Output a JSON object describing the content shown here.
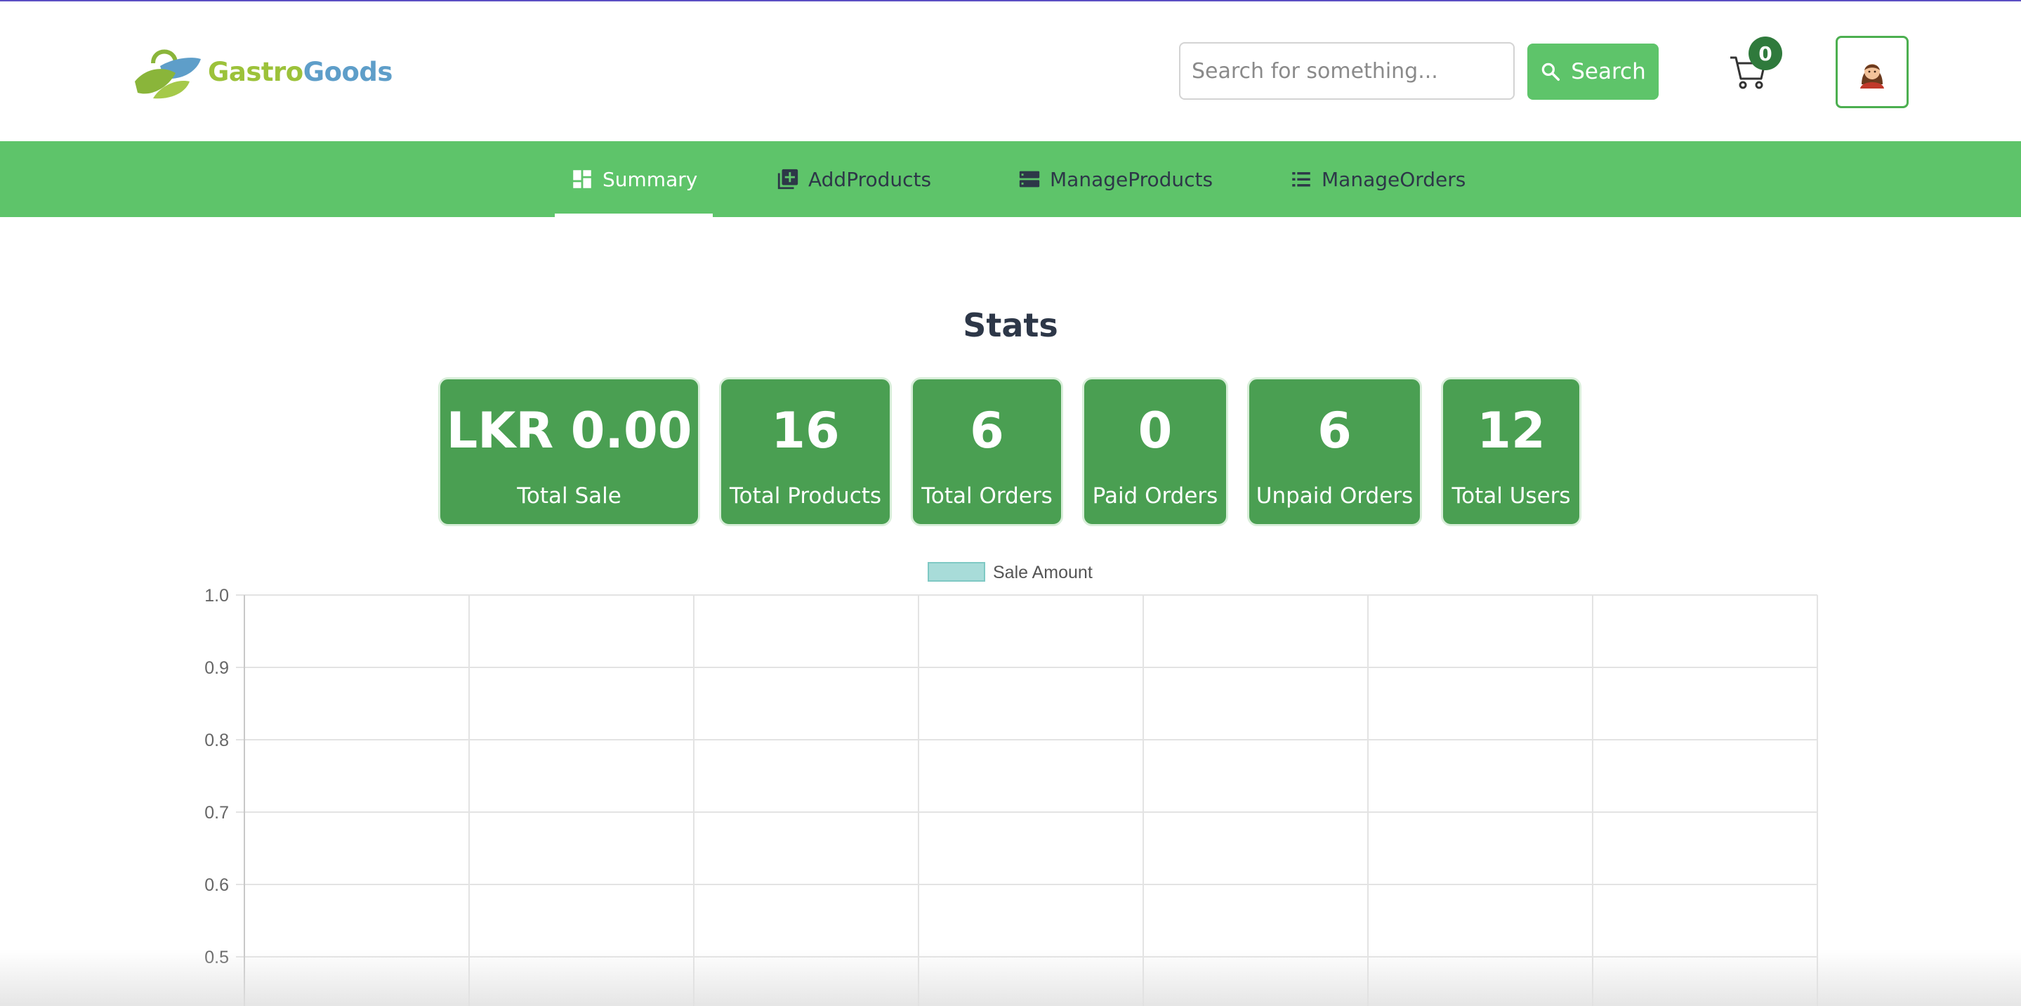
{
  "brand": {
    "name_part1": "Gastro",
    "name_part2": "Goods",
    "colors": {
      "part1": "#9cc23a",
      "part2": "#5e9ec9"
    }
  },
  "header": {
    "search": {
      "placeholder": "Search for something...",
      "value": ""
    },
    "search_button_label": "Search",
    "search_icon": "search-icon",
    "cart_icon": "cart-icon",
    "cart_count": "0",
    "avatar_icon": "woman-avatar-icon"
  },
  "nav": {
    "items": [
      {
        "label": "Summary",
        "icon": "dashboard-icon",
        "active": true
      },
      {
        "label": "AddProducts",
        "icon": "add-box-icon",
        "active": false
      },
      {
        "label": "ManageProducts",
        "icon": "storage-icon",
        "active": false
      },
      {
        "label": "ManageOrders",
        "icon": "list-icon",
        "active": false
      }
    ]
  },
  "stats": {
    "title": "Stats",
    "cards": [
      {
        "value": "LKR 0.00",
        "label": "Total Sale"
      },
      {
        "value": "16",
        "label": "Total Products"
      },
      {
        "value": "6",
        "label": "Total Orders"
      },
      {
        "value": "0",
        "label": "Paid Orders"
      },
      {
        "value": "6",
        "label": "Unpaid Orders"
      },
      {
        "value": "12",
        "label": "Total Users"
      }
    ]
  },
  "colors": {
    "accent": "#5ec46a",
    "card": "#4a9f52",
    "badge": "#2f7a3c",
    "legend_swatch": "#a8dcd9"
  },
  "chart_data": {
    "type": "bar",
    "categories": [
      "",
      "",
      "",
      "",
      "",
      "",
      ""
    ],
    "series": [
      {
        "name": "Sale Amount",
        "values": []
      }
    ],
    "yticks": [
      "1.0",
      "0.9",
      "0.8",
      "0.7",
      "0.6",
      "0.5"
    ],
    "ylim": [
      0,
      1.0
    ],
    "grid": true,
    "legend": "top-center"
  }
}
